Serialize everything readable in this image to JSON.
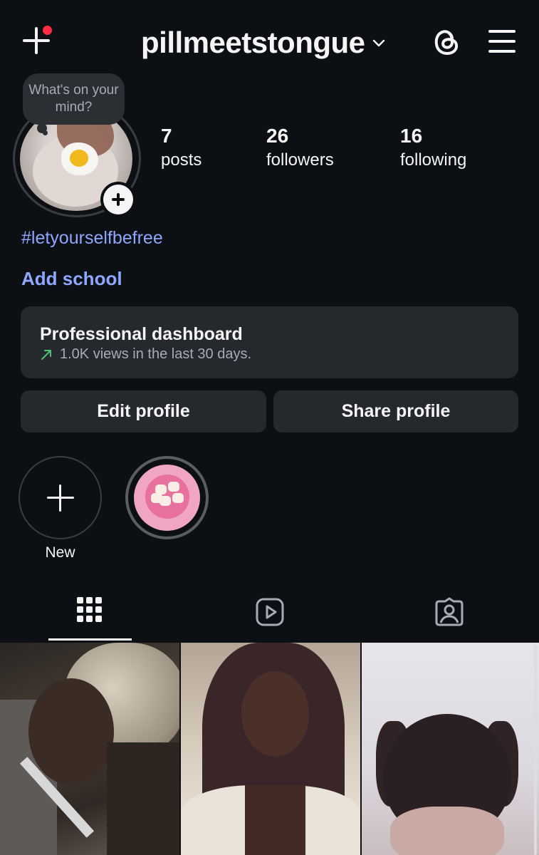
{
  "header": {
    "username": "pillmeetstongue",
    "icons": [
      "add-post-icon",
      "chevron-down-icon",
      "threads-icon",
      "menu-icon"
    ],
    "notification_dot_color": "#ff2d43"
  },
  "profile": {
    "note_bubble": "What's on your mind?",
    "stats": [
      {
        "num": "7",
        "label": "posts"
      },
      {
        "num": "26",
        "label": "followers"
      },
      {
        "num": "16",
        "label": "following"
      }
    ],
    "bio_hashtag": "#letyourselfbefree",
    "add_school": "Add school",
    "link_color": "#8ea7ff"
  },
  "dashboard": {
    "title": "Professional dashboard",
    "subtitle": "1.0K views in the last 30 days.",
    "trend_color": "#4fc36e"
  },
  "buttons": {
    "edit_profile": "Edit profile",
    "share_profile": "Share profile"
  },
  "highlights": {
    "new_label": "New"
  },
  "tabs": {
    "items": [
      "grid-icon",
      "reels-icon",
      "tagged-icon"
    ],
    "active": "grid-icon"
  },
  "posts": {
    "count_visible": 3
  }
}
